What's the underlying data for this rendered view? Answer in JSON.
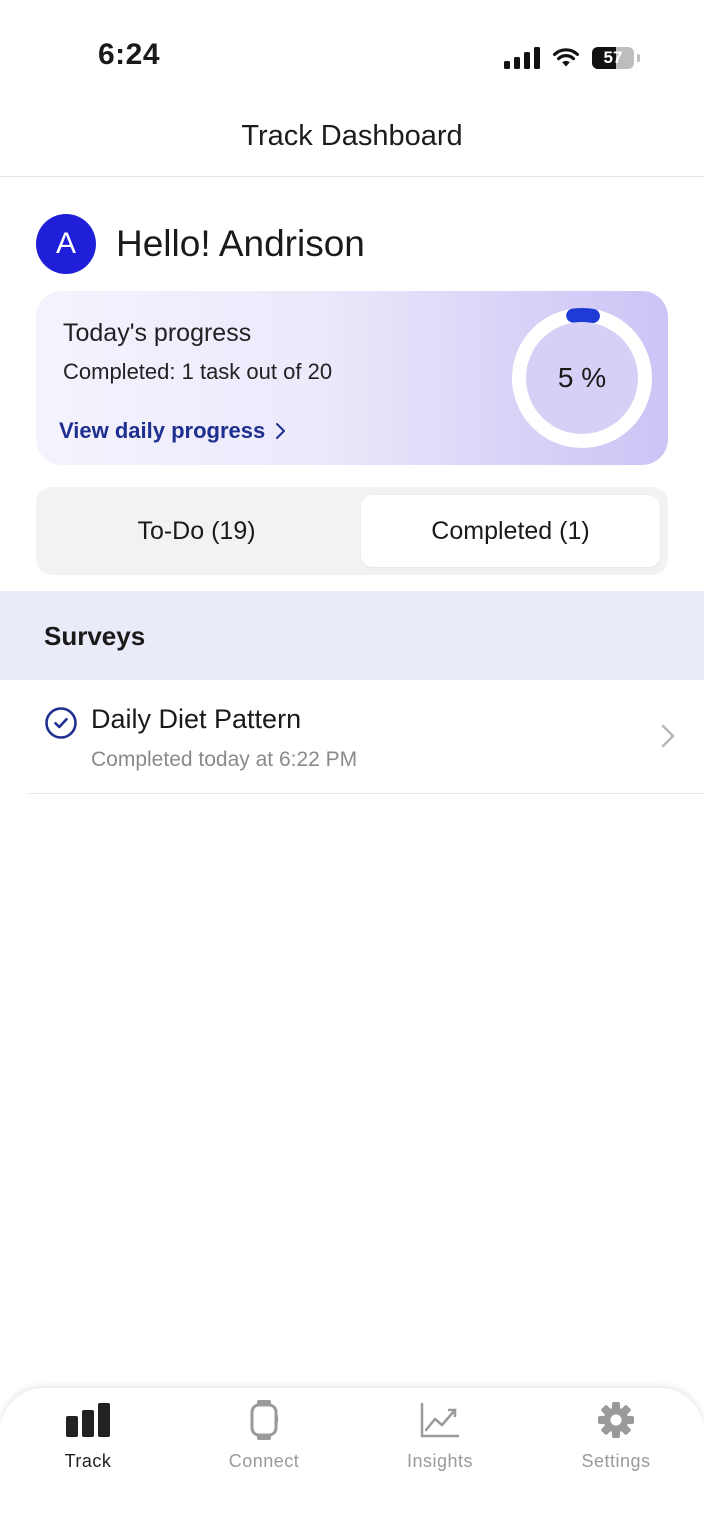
{
  "status_bar": {
    "time": "6:24",
    "battery": "57",
    "battery_level": 0.57
  },
  "header": {
    "title": "Track Dashboard"
  },
  "greeting": {
    "avatar_initial": "A",
    "text": "Hello! Andrison"
  },
  "progress_card": {
    "title": "Today's progress",
    "subtitle": "Completed: 1 task out of 20",
    "link_label": "View daily progress",
    "percent_label": "5 %",
    "percent": 5,
    "accent_color": "#1f3bd6"
  },
  "segments": {
    "todo_label": "To-Do (19)",
    "completed_label": "Completed (1)",
    "selected": "completed"
  },
  "section": {
    "title": "Surveys"
  },
  "items": [
    {
      "title": "Daily Diet Pattern",
      "subtitle": "Completed today at 6:22 PM",
      "icon": "check-circle-icon"
    }
  ],
  "tab_bar": {
    "tabs": [
      {
        "label": "Track",
        "icon": "bar-chart-icon",
        "active": true
      },
      {
        "label": "Connect",
        "icon": "watch-icon",
        "active": false
      },
      {
        "label": "Insights",
        "icon": "trend-line-icon",
        "active": false
      },
      {
        "label": "Settings",
        "icon": "gear-icon",
        "active": false
      }
    ]
  },
  "colors": {
    "brand": "#1f1fd9",
    "link": "#1e2f8f",
    "section_bg": "#eaebf8"
  }
}
